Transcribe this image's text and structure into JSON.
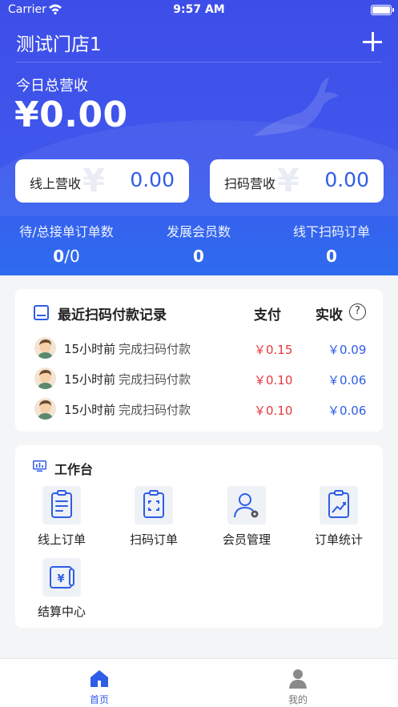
{
  "statusbar": {
    "carrier": "Carrier",
    "time": "9:57 AM"
  },
  "header": {
    "store_name": "测试门店1"
  },
  "revenue": {
    "label": "今日总营收",
    "value": "¥0.00"
  },
  "mini_cards": [
    {
      "label": "线上营收",
      "value": "0.00",
      "yen": "¥"
    },
    {
      "label": "扫码营收",
      "value": "0.00",
      "yen": "¥"
    }
  ],
  "stats": [
    {
      "label": "待/总接单订单数",
      "value": "0",
      "value2": "0",
      "sep": "/"
    },
    {
      "label": "发展会员数",
      "value": "0"
    },
    {
      "label": "线下扫码订单",
      "value": "0"
    }
  ],
  "records": {
    "title": "最近扫码付款记录",
    "col_pay": "支付",
    "col_receive": "实收",
    "help": "?",
    "rows": [
      {
        "time": "15小时前",
        "action": "完成扫码付款",
        "pay": "￥0.15",
        "receive": "￥0.09"
      },
      {
        "time": "15小时前",
        "action": "完成扫码付款",
        "pay": "￥0.10",
        "receive": "￥0.06"
      },
      {
        "time": "15小时前",
        "action": "完成扫码付款",
        "pay": "￥0.10",
        "receive": "￥0.06"
      }
    ]
  },
  "workbench": {
    "title": "工作台",
    "tools": [
      {
        "label": "线上订单",
        "icon": "online-order-icon"
      },
      {
        "label": "扫码订单",
        "icon": "scan-order-icon"
      },
      {
        "label": "会员管理",
        "icon": "member-manage-icon"
      },
      {
        "label": "订单统计",
        "icon": "order-stats-icon"
      },
      {
        "label": "结算中心",
        "icon": "settlement-icon"
      }
    ]
  },
  "tabbar": {
    "home": "首页",
    "mine": "我的"
  },
  "colors": {
    "brand_blue": "#2f5de8",
    "pay_red": "#e8383d",
    "hero_start": "#3d4ee8",
    "hero_end": "#2d6cf0"
  }
}
